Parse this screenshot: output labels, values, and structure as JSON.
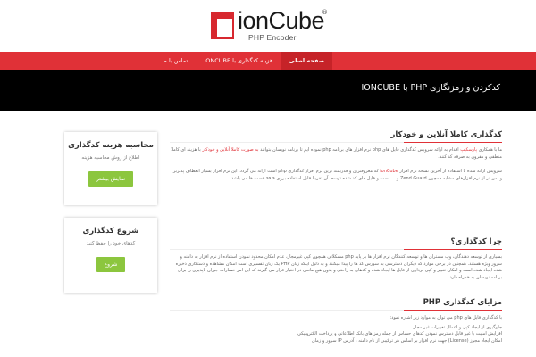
{
  "logo": {
    "name": "ionCube",
    "reg": "®",
    "sub": "PHP Encoder"
  },
  "nav": [
    {
      "label": "صفحه اصلی",
      "active": true
    },
    {
      "label": "هزینه کدگذاری با IONCUBE",
      "active": false
    },
    {
      "label": "تماس با ما",
      "active": false
    }
  ],
  "banner": {
    "title": "کدکردن و رمزنگاری PHP با IONCUBE"
  },
  "sidebar": {
    "box1": {
      "title": "محاسبه هزینه کدگذاری",
      "text": "اطلاع از روش محاسبه هزینه",
      "button": "نمایش بیشتر"
    },
    "box2": {
      "title": "شروع کدگذاری",
      "text": "کدهای خود را حفظ کنید",
      "button": "شروع"
    }
  },
  "content": {
    "s1": {
      "title": "کدگذاری کاملا آنلاین و خودکار",
      "p1a": "ما با همکاری",
      "p1link": "پارسکیپ",
      "p1b": "اقدام به ارائه سرویس کدگذاری فایل های php نرم افزار های برنامه php",
      "p1c": "نموده ایم تا برنامه نویسان بتوانند",
      "p1link2": "به صورت کاملا آنلاین و خودکار",
      "p1d": "با هزینه ای کاملا منطقی و مقرون به صرفه کد کنند.",
      "p2a": "سرویس ارائه شده با استفاده از آخرین نسخه نرم افزار",
      "p2link": "ionCube",
      "p2b": "که معروفترین و قدرتمند ترین نرم افزار کدگذاری php است ارائه می گردد. این نرم افزار بسیار انعطاف پذیرتر و امن تر از نرم افزارهای مشابه همچون Zend Guard و ... است و فایل های کد شده توسط آن تقریبا قابل استفاده بروی ۹۹.۹ هست ها می باشد."
    },
    "s2": {
      "title": "چرا کدگذاری؟",
      "p": "بسیاری از توسعه دهندگان، وب مستران ها و توسعه کنندگان نرم افزار ها بر پایه php مشکلاتی همچون کپی غیرمجاز، عدم امکان محدود نمودن استفاده از نرم افزار به دامنه و سرور ویژه هستند. همچنین در برخی موارد که دیگران دسترسی به سورس کد ها را پیدا میکنند و به دلیل اینکه زبان PHP یک زبان تفسیری است امکان مشاهده و دستکاری ذخیره شده ایجاد شده است و امکان تغییر و کپی برداری از فایل ها ایجاد شده و کدهای به راحتی و بدون هیچ مانعی در اختیار قرار می گیرند که این امر خسارات جبران ناپذیری را برای برنامه نویسان به همراه دارد."
    },
    "s3": {
      "title": "مزایای کدگذاری PHP",
      "p1": "با کدگذاری فایل های php می توان به موارد زیر اشاره نمود:",
      "p2": "جلوگیری از ایجاد کپی و اعمال تغییرات غیر مجاز",
      "p3": "افزایش امنیت با غیر قابل دسترس نمودن کدهای حساس از جمله رمز های بانک اطلاعاتی و پرداخت الکترونیکی",
      "p4": "امکان ایجاد مجوز (License) جهت نرم افزار بر اساس هر ترکیبی از نام دامنه ، آدرس IP سرور و زمان"
    }
  }
}
